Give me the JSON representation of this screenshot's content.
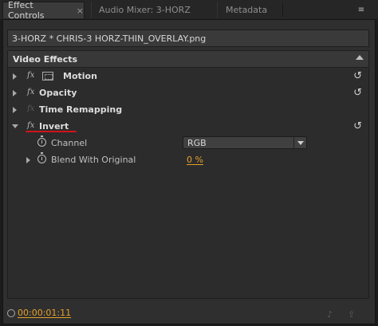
{
  "tabs": [
    {
      "label": "Effect Controls",
      "active": true,
      "close": "×"
    },
    {
      "label": "Audio Mixer: 3-HORZ",
      "active": false
    },
    {
      "label": "Metadata",
      "active": false
    }
  ],
  "panel_menu_icon": "≡",
  "clip_name": "3-HORZ * CHRIS-3 HORZ-THIN_OVERLAY.png",
  "section_title": "Video Effects",
  "fx_glyph": "fx",
  "effects": [
    {
      "name": "Motion",
      "has_reset": true,
      "fx_enabled": true
    },
    {
      "name": "Opacity",
      "has_reset": true,
      "fx_enabled": true
    },
    {
      "name": "Time Remapping",
      "has_reset": false,
      "fx_enabled": false
    },
    {
      "name": "Invert",
      "has_reset": true,
      "fx_enabled": true,
      "expanded": true
    }
  ],
  "invert_params": {
    "channel": {
      "label": "Channel",
      "value": "RGB"
    },
    "blend": {
      "label": "Blend With Original",
      "value": "0 %"
    }
  },
  "reset_glyph": "↺",
  "footer": {
    "timecode": "00:00:01:11"
  },
  "colors": {
    "accent": "#e5a12a",
    "annotation_underline": "#d0141a"
  }
}
